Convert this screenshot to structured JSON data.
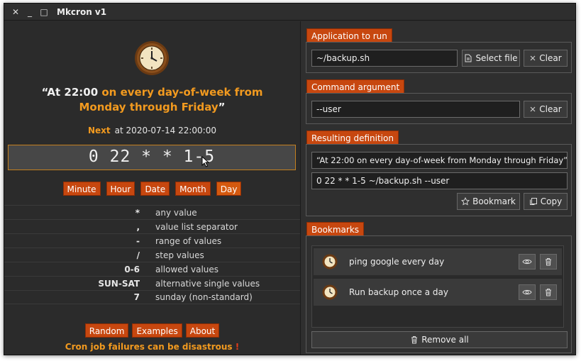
{
  "window": {
    "title": "Mkcron v1",
    "close_glyph": "✕",
    "minimize_glyph": "_",
    "maximize_glyph": "□"
  },
  "description": {
    "prefix": "“At 22:00 ",
    "highlight": "on every day-of-week from Monday through Friday",
    "suffix": "”"
  },
  "next": {
    "label": "Next",
    "value": "at 2020-07-14 22:00:00"
  },
  "expression": "0 22 * * 1-5",
  "fields": [
    {
      "label": "Minute"
    },
    {
      "label": "Hour"
    },
    {
      "label": "Date"
    },
    {
      "label": "Month"
    },
    {
      "label": "Day"
    }
  ],
  "legend": [
    {
      "symbol": "*",
      "text": "any value"
    },
    {
      "symbol": ",",
      "text": "value list separator"
    },
    {
      "symbol": "-",
      "text": "range of values"
    },
    {
      "symbol": "/",
      "text": "step values"
    },
    {
      "symbol": "0-6",
      "text": "allowed values"
    },
    {
      "symbol": "SUN-SAT",
      "text": "alternative single values"
    },
    {
      "symbol": "7",
      "text": "sunday (non-standard)"
    }
  ],
  "bottom_buttons": {
    "random": "Random",
    "examples": "Examples",
    "about": "About"
  },
  "footer": {
    "message": "Cron job failures can be disastrous",
    "exclamation": "!"
  },
  "app_section": {
    "label": "Application to run",
    "value": "~/backup.sh",
    "select_file": "Select file",
    "clear": "Clear"
  },
  "arg_section": {
    "label": "Command argument",
    "value": "--user",
    "clear": "Clear"
  },
  "result_section": {
    "label": "Resulting definition",
    "description": "“At 22:00 on every day-of-week from Monday through Friday”",
    "definition": "0 22 * * 1-5 ~/backup.sh --user",
    "bookmark": "Bookmark",
    "copy": "Copy"
  },
  "bookmarks_section": {
    "label": "Bookmarks",
    "items": [
      {
        "name": "ping google every day"
      },
      {
        "name": "Run backup once a day"
      }
    ],
    "remove_all": "Remove all"
  },
  "colors": {
    "accent": "#c7470f",
    "highlight": "#f29a1f",
    "background": "#2b2b2b"
  }
}
